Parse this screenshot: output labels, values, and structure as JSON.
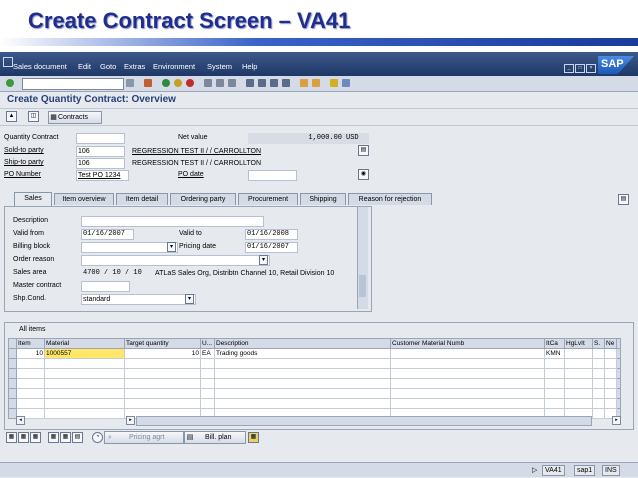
{
  "slide_title": "Create Contract Screen – VA41",
  "menubar": {
    "items": [
      "Sales document",
      "Edit",
      "Goto",
      "Extras",
      "Environment",
      "System",
      "Help"
    ],
    "logo": "SAP"
  },
  "screen_title": "Create Quantity Contract: Overview",
  "app_toolbar": {
    "contracts_label": "Contracts"
  },
  "header": {
    "quantity_contract_label": "Quantity Contract",
    "quantity_contract_value": "",
    "net_value_label": "Net value",
    "net_value": "1,000.00",
    "currency": "USD",
    "sold_to_label": "Sold-to party",
    "sold_to_value": "106",
    "sold_to_name": "REGRESSION TEST II / / CARROLLTON",
    "ship_to_label": "Ship-to party",
    "ship_to_value": "106",
    "ship_to_name": "REGRESSION TEST II / / CARROLLTON",
    "po_number_label": "PO Number",
    "po_number_value": "Test PO 1234",
    "po_date_label": "PO date",
    "po_date_value": ""
  },
  "tabs": [
    "Sales",
    "Item overview",
    "Item detail",
    "Ordering party",
    "Procurement",
    "Shipping",
    "Reason for rejection"
  ],
  "sales_tab": {
    "description_label": "Description",
    "valid_from_label": "Valid from",
    "valid_from": "01/16/2007",
    "valid_to_label": "Valid to",
    "valid_to": "01/16/2008",
    "billing_block_label": "Billing block",
    "pricing_date_label": "Pricing date",
    "pricing_date": "01/16/2007",
    "order_reason_label": "Order reason",
    "sales_area_label": "Sales area",
    "sales_area_codes": "4700 / 10 / 10",
    "sales_area_text": "ATLaS Sales Org, Distribtn Channel 10, Retail Division 10",
    "master_contract_label": "Master contract",
    "shp_cond_label": "Shp.Cond.",
    "shp_cond_value": "standard"
  },
  "items": {
    "section_label": "All items",
    "columns": [
      "Item",
      "Material",
      "Target quantity",
      "U...",
      "Description",
      "Customer Material Numb",
      "ItCa",
      "HgLvIt",
      "S.",
      "Ne"
    ],
    "rows": [
      [
        "10",
        "1000557",
        "10",
        "EA",
        "Trading goods",
        "",
        "KMN",
        "",
        "",
        ""
      ]
    ],
    "empty_rows": 6
  },
  "bottom_toolbar": {
    "pricing_agrt_label": "Pricing agrt",
    "bill_plan_label": "Bill. plan"
  },
  "status_bar": {
    "transaction": "VA41",
    "server": "sap1",
    "mode": "INS"
  },
  "colors": {
    "title_blue": "#1f2e8c",
    "menubar": "#2b4778",
    "screen_bg": "#e6e9ee",
    "highlight": "#ffe76a"
  }
}
